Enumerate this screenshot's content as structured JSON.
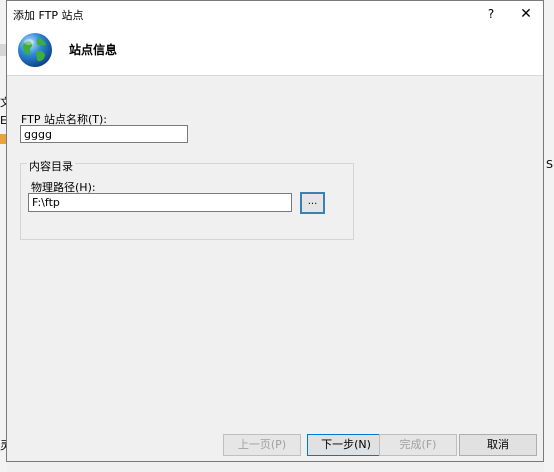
{
  "dialog": {
    "title": "添加 FTP 站点",
    "help_label": "?",
    "close_label": "✕"
  },
  "header": {
    "title": "站点信息"
  },
  "form": {
    "site_name_label": "FTP 站点名称(T):",
    "site_name_value": "gggg",
    "group_label": "内容目录",
    "path_label": "物理路径(H):",
    "path_value": "F:\\ftp",
    "browse_label": "..."
  },
  "footer": {
    "prev_label": "上一页(P)",
    "next_label": "下一步(N)",
    "finish_label": "完成(F)",
    "cancel_label": "取消"
  },
  "background": {
    "left_frag_1": "文",
    "left_frag_2": "E",
    "left_frag_3": "灵",
    "right_frag": "S"
  },
  "colors": {
    "accent": "#0078d7",
    "browse_border": "#3c7fb1"
  }
}
